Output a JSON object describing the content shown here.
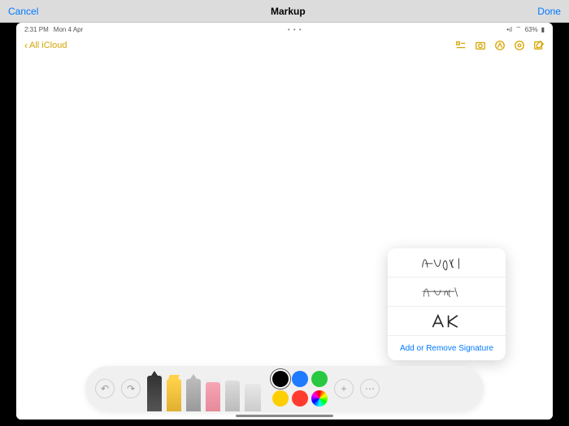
{
  "topbar": {
    "cancel": "Cancel",
    "title": "Markup",
    "done": "Done"
  },
  "status": {
    "time": "2:31 PM",
    "date": "Mon 4 Apr",
    "signal": "•ıl",
    "wifi": "⌵",
    "battery": "63%"
  },
  "notes": {
    "back": "All iCloud"
  },
  "popover": {
    "add_remove": "Add or Remove Signature"
  },
  "dock": {
    "undo": "↶",
    "redo": "↷",
    "add": "+",
    "more": "⋯"
  },
  "colors": {
    "black": "#000",
    "blue": "#1f7bff",
    "green": "#28c940",
    "yellow": "#ffce00",
    "red": "#ff3b30"
  }
}
